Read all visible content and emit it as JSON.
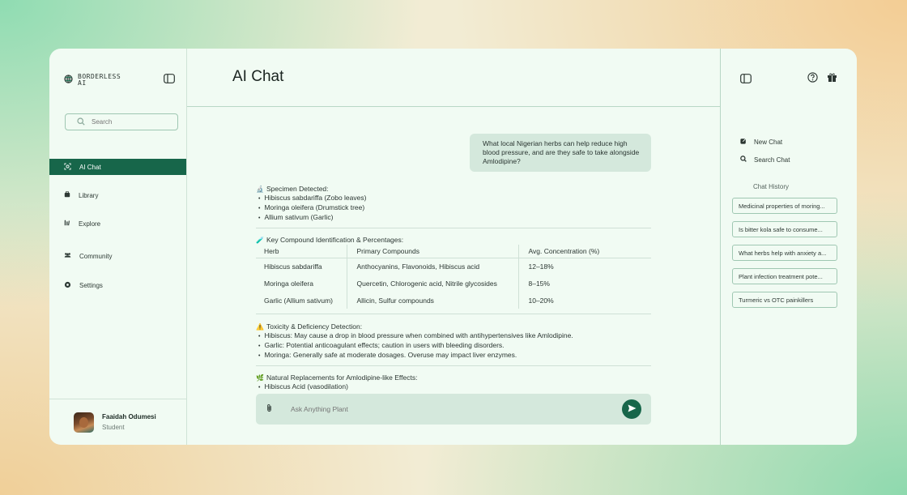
{
  "brand": {
    "name_line1": "BORDERLESS",
    "name_line2": "AI"
  },
  "search": {
    "placeholder": "Search"
  },
  "nav": [
    {
      "label": "AI Chat",
      "icon": "ai-chat-icon",
      "active": true
    },
    {
      "label": "Library",
      "icon": "library-icon"
    },
    {
      "label": "Explore",
      "icon": "explore-icon"
    },
    {
      "label": "Community",
      "icon": "community-icon"
    },
    {
      "label": "Settings",
      "icon": "settings-icon"
    }
  ],
  "profile": {
    "name": "Faaidah Odumesi",
    "role": "Student"
  },
  "main": {
    "title": "AI Chat",
    "user_message": "What local Nigerian herbs can help reduce high blood pressure, and are they safe to take alongside Amlodipine?",
    "specimen": {
      "icon": "🔬",
      "title": "Specimen Detected:",
      "items": [
        "Hibiscus sabdariffa (Zobo leaves)",
        "Moringa oleifera (Drumstick tree)",
        "Allium sativum (Garlic)"
      ]
    },
    "compounds": {
      "icon": "🧪",
      "title": "Key Compound Identification & Percentages:",
      "headers": [
        "Herb",
        "Primary Compounds",
        "Avg. Concentration (%)"
      ],
      "rows": [
        [
          "Hibiscus sabdariffa",
          "Anthocyanins, Flavonoids, Hibiscus acid",
          "12–18%"
        ],
        [
          "Moringa oleifera",
          "Quercetin, Chlorogenic acid, Nitrile glycosides",
          "8–15%"
        ],
        [
          "Garlic (Allium sativum)",
          "Allicin, Sulfur compounds",
          "10–20%"
        ]
      ]
    },
    "toxicity": {
      "icon": "⚠️",
      "title": "Toxicity & Deficiency Detection:",
      "items": [
        "Hibiscus: May cause a drop in blood pressure when combined with antihypertensives like Amlodipine.",
        "Garlic: Potential anticoagulant effects; caution in users with bleeding disorders.",
        "Moringa: Generally safe at moderate dosages. Overuse may impact liver enzymes."
      ]
    },
    "replacements": {
      "icon": "🌿",
      "title": "Natural Replacements for Amlodipine-like Effects:",
      "items": [
        "Hibiscus Acid (vasodilation)"
      ]
    },
    "composer_placeholder": "Ask Anything Plant"
  },
  "right_panel": {
    "new_chat": "New Chat",
    "search_chat": "Search Chat",
    "history_label": "Chat History",
    "history": [
      "Medicinal properties of moring...",
      "Is bitter kola safe to consume...",
      "What herbs help with anxiety a...",
      "Plant infection treatment pote...",
      "Turmeric vs OTC painkillers"
    ]
  },
  "colors": {
    "accent": "#17664a",
    "panel_bg": "#f1fbf3",
    "bubble_bg": "#d4e8dc"
  }
}
